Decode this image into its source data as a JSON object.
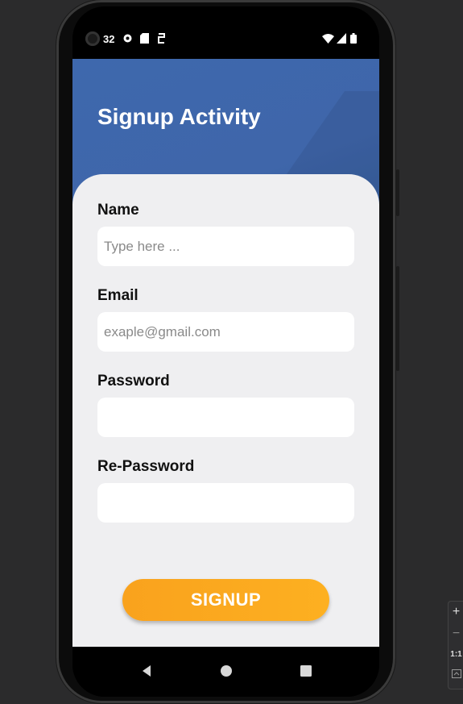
{
  "status_bar": {
    "time": "32",
    "left_icons": [
      "camera-lens-icon",
      "notification-icon",
      "sd-card-icon",
      "sync-icon"
    ],
    "right_icons": [
      "wifi-icon",
      "signal-icon",
      "battery-icon"
    ]
  },
  "header": {
    "title": "Signup Activity",
    "color": "#3e68ad"
  },
  "form": {
    "name": {
      "label": "Name",
      "value": "",
      "placeholder": "Type here ..."
    },
    "email": {
      "label": "Email",
      "value": "",
      "placeholder": "exaple@gmail.com"
    },
    "password": {
      "label": "Password",
      "value": "",
      "placeholder": ""
    },
    "repassword": {
      "label": "Re-Password",
      "value": "",
      "placeholder": ""
    }
  },
  "signup_button": {
    "label": "SIGNUP",
    "color": "#f9a21d"
  },
  "nav_bar": {
    "icons": [
      "back-icon",
      "home-icon",
      "recents-icon"
    ]
  },
  "emulator_controls": {
    "plus": "+",
    "minus": "−",
    "ratio": "1:1"
  }
}
